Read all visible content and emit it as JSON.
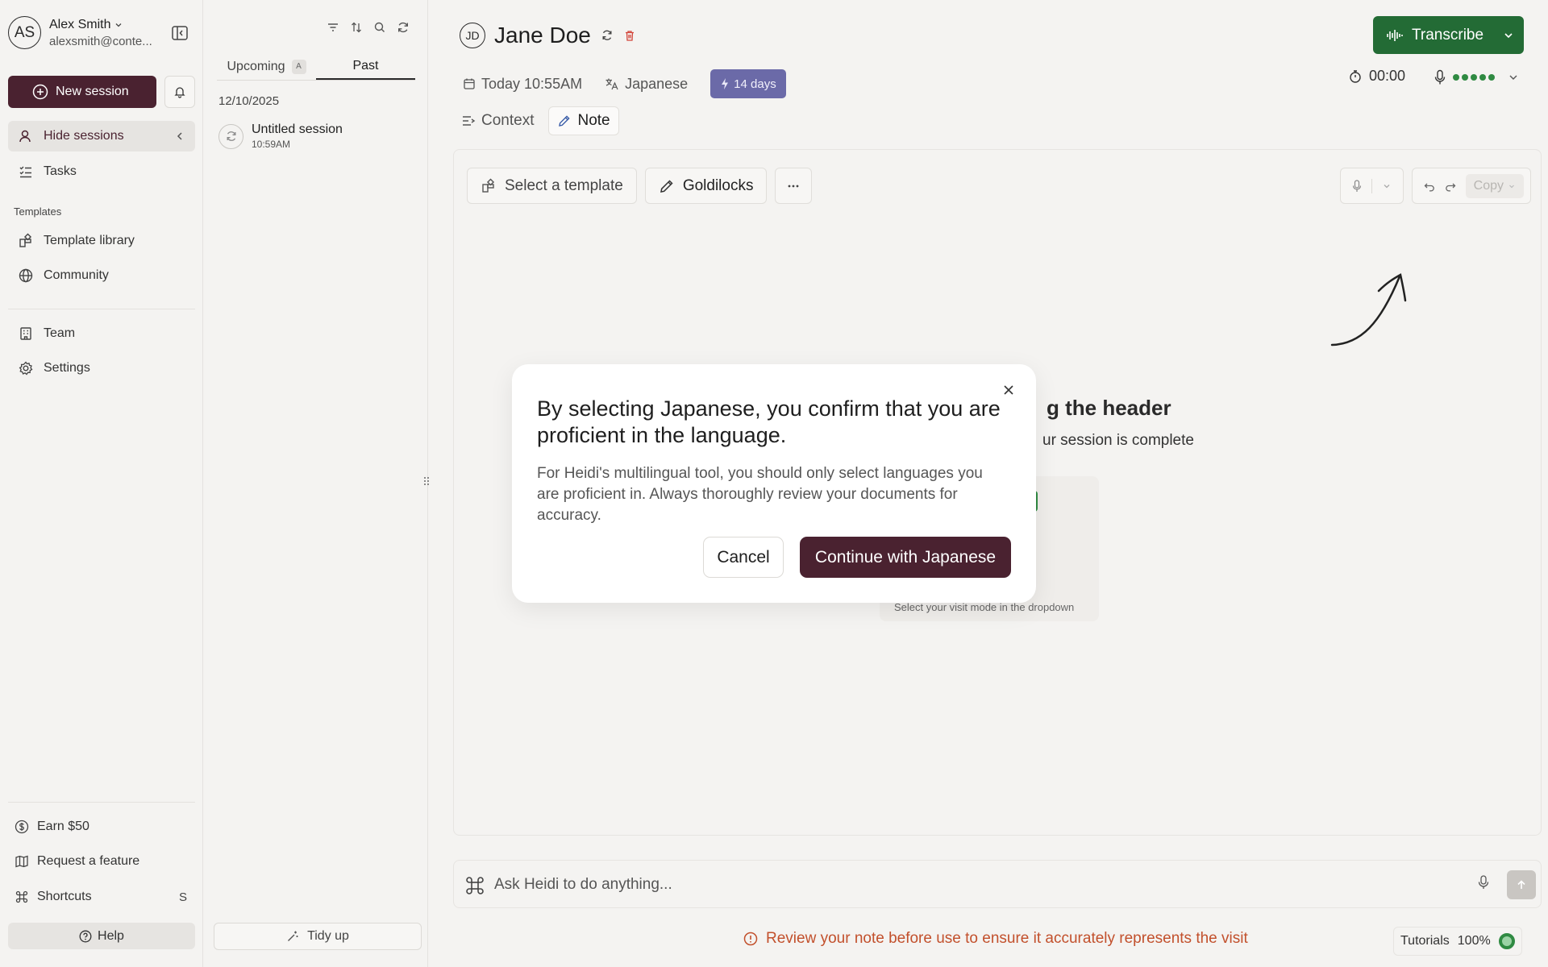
{
  "account": {
    "initials": "AS",
    "name": "Alex Smith",
    "email": "alexsmith@conte..."
  },
  "sidebar": {
    "new_session": "New session",
    "hide_sessions": "Hide sessions",
    "tasks": "Tasks",
    "templates_label": "Templates",
    "template_library": "Template library",
    "community": "Community",
    "team": "Team",
    "settings": "Settings",
    "earn": "Earn $50",
    "request_feature": "Request a feature",
    "shortcuts": "Shortcuts",
    "shortcuts_key": "S",
    "help": "Help"
  },
  "sessions": {
    "tab_upcoming": "Upcoming",
    "tab_upcoming_badge": "A",
    "tab_past": "Past",
    "date": "12/10/2025",
    "items": [
      {
        "title": "Untitled session",
        "time": "10:59AM"
      }
    ],
    "tidy_up": "Tidy up"
  },
  "header": {
    "patient_initials": "JD",
    "patient_name": "Jane Doe",
    "transcribe": "Transcribe",
    "date": "Today 10:55AM",
    "language": "Japanese",
    "days_badge": "14 days",
    "timer": "00:00",
    "tab_context": "Context",
    "tab_note": "Note"
  },
  "editor": {
    "select_template": "Select a template",
    "goldilocks": "Goldilocks",
    "copy": "Copy",
    "hint_title_visible": "g the header",
    "hint_sub_visible": "ur session is complete",
    "hint_caption": "Select your visit mode in the dropdown"
  },
  "chat": {
    "placeholder": "Ask Heidi to do anything..."
  },
  "footer": {
    "warning": "Review your note before use to ensure it accurately represents the visit",
    "tutorials": "Tutorials",
    "progress": "100%"
  },
  "modal": {
    "title": "By selecting Japanese, you confirm that you are proficient in the language.",
    "body": "For Heidi's multilingual tool, you should only select languages you are proficient in. Always thoroughly review your documents for accuracy.",
    "cancel": "Cancel",
    "continue": "Continue with Japanese"
  },
  "colors": {
    "brand": "#4a2230",
    "transcribe": "#236b35",
    "badge": "#6b6aa8",
    "warning": "#c2502c"
  }
}
